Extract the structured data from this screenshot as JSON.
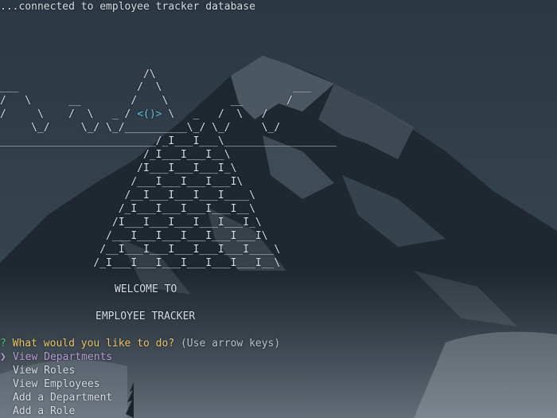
{
  "terminal": {
    "status_line": "...connected to employee tracker database",
    "ascii_art": [
      "                       /\\",
      "___                   /  \\                     ___",
      "/   \\      __        /    \\          __       /",
      "/     \\    /  \\   _ / ",
      "     \\_/     \\_/ \\_/__________\\_/ \\_/     \\_/",
      "_________________________/_I___I___\\__________________",
      "                       /_I___I___I__\\",
      "                      /I___I___I___I_\\",
      "                     /___I___I___I___I\\",
      "                    /__I___I___I___I____\\",
      "                   /_I___I___I___I___I__\\",
      "                  /I___I___I___I___I___I_\\",
      "                 /___I___I___I___I___I___I\\",
      "                /__I___I___I___I___I___I____\\",
      "               /_I___I___I___I___I___I___I__\\"
    ],
    "eye_line_prefix": "/     \\    /  \\   _ / ",
    "eye_symbol": "<()>",
    "eye_line_suffix": " \\   _   /  \\   /",
    "welcome_line_1": "WELCOME TO",
    "welcome_line_2": "EMPLOYEE TRACKER",
    "prompt": {
      "mark": "?",
      "question": "What would you like to do?",
      "hint": "(Use arrow keys)"
    },
    "pointer_symbol": "❯",
    "options": [
      "View Departments",
      "View Roles",
      "View Employees",
      "Add a Department",
      "Add a Role"
    ],
    "selected_option": "View Departments"
  }
}
